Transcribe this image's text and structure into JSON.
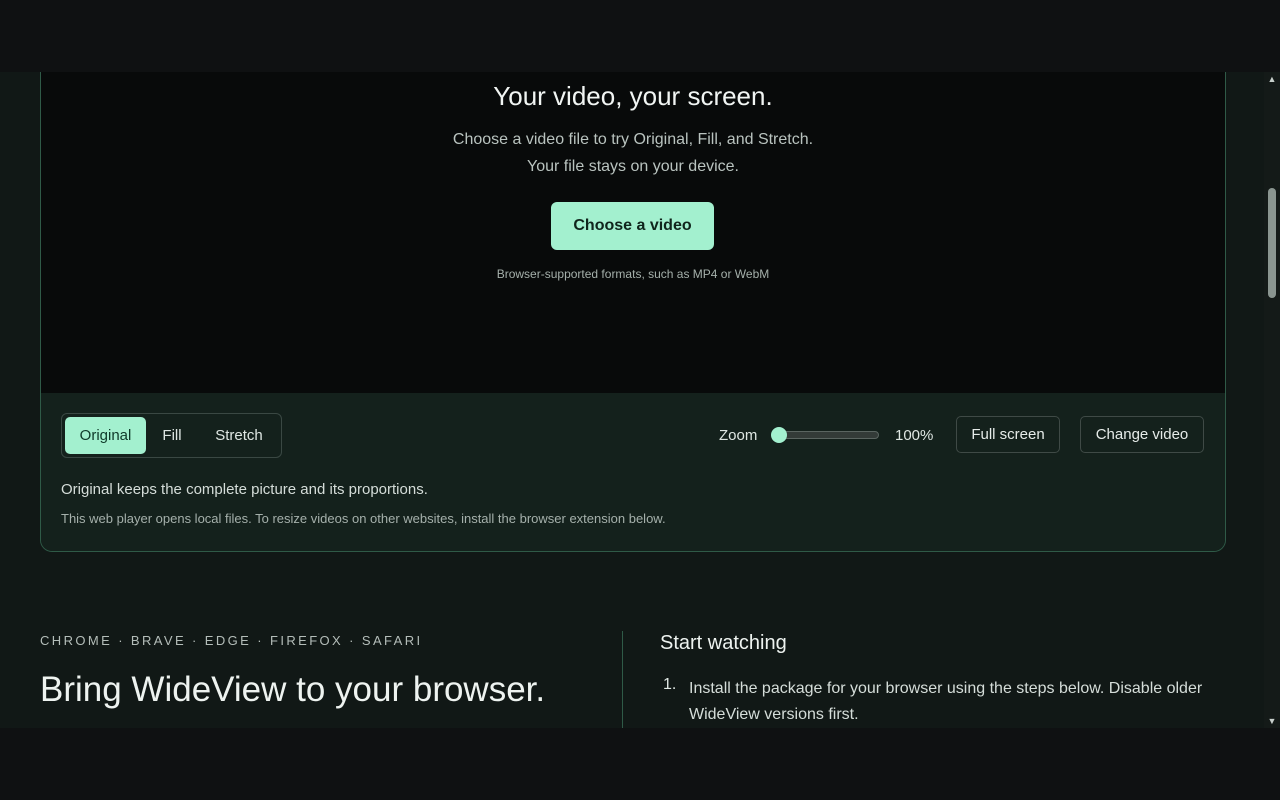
{
  "stage": {
    "title": "Your video, your screen.",
    "subtitle_line1": "Choose a video file to try Original, Fill, and Stretch.",
    "subtitle_line2": "Your file stays on your device.",
    "choose_button": "Choose a video",
    "formats_note": "Browser-supported formats, such as MP4 or WebM"
  },
  "controls": {
    "modes": [
      "Original",
      "Fill",
      "Stretch"
    ],
    "selected_mode": "Original",
    "zoom_label": "Zoom",
    "zoom_value": "100%",
    "zoom_fraction": 0,
    "fullscreen_button": "Full screen",
    "change_button": "Change video",
    "mode_description": "Original keeps the complete picture and its proportions.",
    "web_note": "This web player opens local files. To resize videos on other websites, install the browser extension below."
  },
  "install": {
    "browsers": "CHROME · BRAVE · EDGE · FIREFOX · SAFARI",
    "title": "Bring WideView to your browser.",
    "start_title": "Start watching",
    "steps": [
      {
        "num": "1.",
        "text": "Install the package for your browser using the steps below. Disable older WideView versions first."
      }
    ]
  },
  "colors": {
    "accent": "#a3f0cf",
    "border_accent": "#2f5a47",
    "stage_bg": "#080a0a",
    "page_bg": "#111816"
  },
  "icons": {
    "scroll_up": "triangle-up-icon",
    "scroll_down": "triangle-down-icon"
  }
}
